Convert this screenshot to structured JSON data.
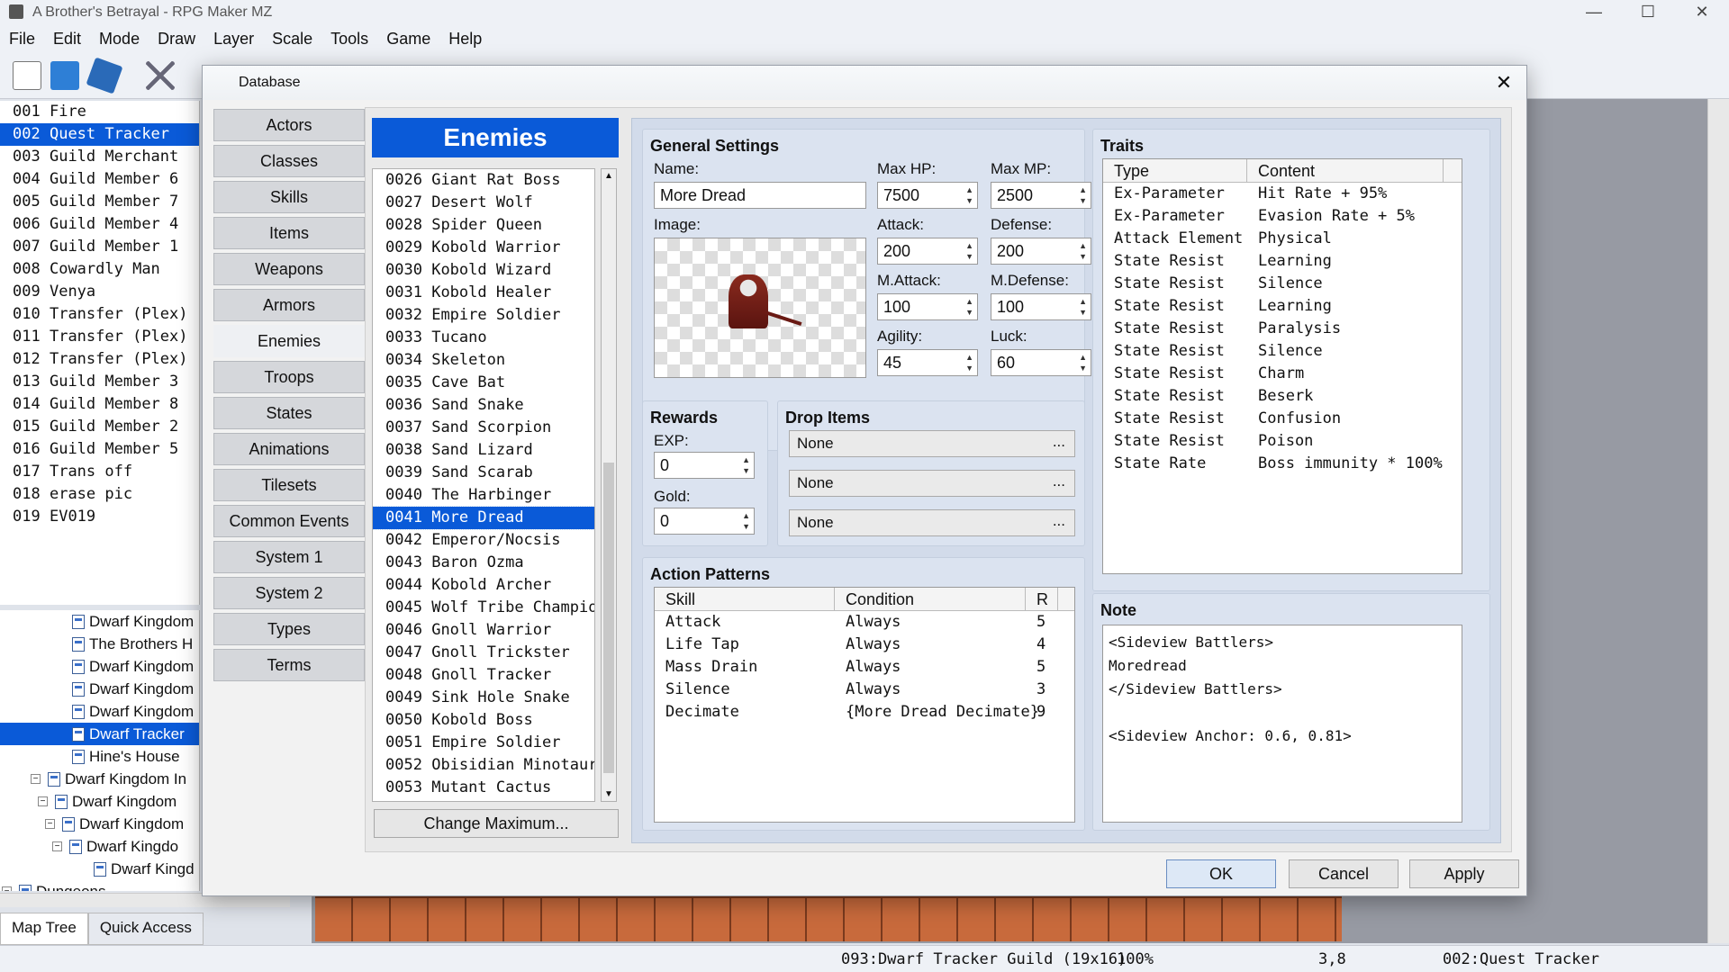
{
  "app": {
    "title": "A Brother's Betrayal - RPG Maker MZ",
    "menus": [
      "File",
      "Edit",
      "Mode",
      "Draw",
      "Layer",
      "Scale",
      "Tools",
      "Game",
      "Help"
    ],
    "win_controls": [
      "—",
      "☐",
      "✕"
    ]
  },
  "events": [
    {
      "id": "001",
      "name": "Fire"
    },
    {
      "id": "002",
      "name": "Quest Tracker"
    },
    {
      "id": "003",
      "name": "Guild Merchant"
    },
    {
      "id": "004",
      "name": "Guild Member 6"
    },
    {
      "id": "005",
      "name": "Guild Member 7"
    },
    {
      "id": "006",
      "name": "Guild Member 4"
    },
    {
      "id": "007",
      "name": "Guild Member 1"
    },
    {
      "id": "008",
      "name": "Cowardly Man"
    },
    {
      "id": "009",
      "name": "Venya"
    },
    {
      "id": "010",
      "name": "Transfer (Plex)"
    },
    {
      "id": "011",
      "name": "Transfer (Plex)"
    },
    {
      "id": "012",
      "name": "Transfer (Plex)"
    },
    {
      "id": "013",
      "name": "Guild Member 3"
    },
    {
      "id": "014",
      "name": "Guild Member 8"
    },
    {
      "id": "015",
      "name": "Guild Member 2"
    },
    {
      "id": "016",
      "name": "Guild Member 5"
    },
    {
      "id": "017",
      "name": "Trans off"
    },
    {
      "id": "018",
      "name": "erase pic"
    },
    {
      "id": "019",
      "name": "EV019"
    }
  ],
  "maptree": [
    "Dwarf Kingdom",
    "The Brothers H",
    "Dwarf Kingdom",
    "Dwarf Kingdom",
    "Dwarf Kingdom",
    "Dwarf Tracker",
    "Hine's House",
    "Dwarf Kingdom In",
    "Dwarf Kingdom",
    "Dwarf Kingdom",
    "Dwarf Kingdo",
    "Dwarf Kingd",
    "Dungeons"
  ],
  "bottom_tabs": [
    "Map Tree",
    "Quick Access"
  ],
  "status": {
    "map": "093:Dwarf Tracker Guild (19x16)",
    "zoom": "100%",
    "coords": "3,8",
    "event": "002:Quest Tracker"
  },
  "dialog": {
    "title": "Database",
    "close": "✕",
    "categories": [
      "Actors",
      "Classes",
      "Skills",
      "Items",
      "Weapons",
      "Armors",
      "Enemies",
      "Troops",
      "States",
      "Animations",
      "Tilesets",
      "Common Events",
      "System 1",
      "System 2",
      "Types",
      "Terms"
    ],
    "header": "Enemies",
    "enemies": [
      {
        "id": "0026",
        "name": "Giant Rat Boss"
      },
      {
        "id": "0027",
        "name": "Desert Wolf"
      },
      {
        "id": "0028",
        "name": "Spider Queen"
      },
      {
        "id": "0029",
        "name": "Kobold Warrior"
      },
      {
        "id": "0030",
        "name": "Kobold Wizard"
      },
      {
        "id": "0031",
        "name": "Kobold Healer"
      },
      {
        "id": "0032",
        "name": "Empire Soldier"
      },
      {
        "id": "0033",
        "name": "Tucano"
      },
      {
        "id": "0034",
        "name": "Skeleton"
      },
      {
        "id": "0035",
        "name": "Cave Bat"
      },
      {
        "id": "0036",
        "name": "Sand Snake"
      },
      {
        "id": "0037",
        "name": "Sand Scorpion"
      },
      {
        "id": "0038",
        "name": "Sand Lizard"
      },
      {
        "id": "0039",
        "name": "Sand Scarab"
      },
      {
        "id": "0040",
        "name": "The Harbinger"
      },
      {
        "id": "0041",
        "name": "More Dread"
      },
      {
        "id": "0042",
        "name": "Emperor/Nocsis"
      },
      {
        "id": "0043",
        "name": "Baron Ozma"
      },
      {
        "id": "0044",
        "name": "Kobold Archer"
      },
      {
        "id": "0045",
        "name": "Wolf Tribe Champion"
      },
      {
        "id": "0046",
        "name": "Gnoll Warrior"
      },
      {
        "id": "0047",
        "name": "Gnoll Trickster"
      },
      {
        "id": "0048",
        "name": "Gnoll Tracker"
      },
      {
        "id": "0049",
        "name": "Sink Hole Snake"
      },
      {
        "id": "0050",
        "name": "Kobold Boss"
      },
      {
        "id": "0051",
        "name": "Empire Soldier"
      },
      {
        "id": "0052",
        "name": "Obisidian Minotaur"
      },
      {
        "id": "0053",
        "name": "Mutant Cactus"
      }
    ],
    "change_max": "Change Maximum...",
    "general": {
      "title": "General Settings",
      "name_label": "Name:",
      "name": "More Dread",
      "image_label": "Image:",
      "maxhp_label": "Max HP:",
      "maxhp": "7500",
      "maxmp_label": "Max MP:",
      "maxmp": "2500",
      "atk_label": "Attack:",
      "atk": "200",
      "def_label": "Defense:",
      "def": "200",
      "matk_label": "M.Attack:",
      "matk": "100",
      "mdef_label": "M.Defense:",
      "mdef": "100",
      "agi_label": "Agility:",
      "agi": "45",
      "luk_label": "Luck:",
      "luk": "60"
    },
    "rewards": {
      "title": "Rewards",
      "exp_label": "EXP:",
      "exp": "0",
      "gold_label": "Gold:",
      "gold": "0"
    },
    "drops": {
      "title": "Drop Items",
      "items": [
        "None",
        "None",
        "None"
      ],
      "dots": "..."
    },
    "actions": {
      "title": "Action Patterns",
      "cols": [
        "Skill",
        "Condition",
        "R"
      ],
      "rows": [
        [
          "Attack",
          "Always",
          "5"
        ],
        [
          "Life Tap",
          "Always",
          "4"
        ],
        [
          "Mass Drain",
          "Always",
          "5"
        ],
        [
          "Silence",
          "Always",
          "3"
        ],
        [
          "Decimate",
          "{More Dread Decimate}",
          "9"
        ]
      ]
    },
    "traits": {
      "title": "Traits",
      "cols": [
        "Type",
        "Content"
      ],
      "rows": [
        [
          "Ex-Parameter",
          "Hit Rate + 95%"
        ],
        [
          "Ex-Parameter",
          "Evasion Rate + 5%"
        ],
        [
          "Attack Element",
          "Physical"
        ],
        [
          "State Resist",
          "Learning"
        ],
        [
          "State Resist",
          "Silence"
        ],
        [
          "State Resist",
          "Learning"
        ],
        [
          "State Resist",
          "Paralysis"
        ],
        [
          "State Resist",
          "Silence"
        ],
        [
          "State Resist",
          "Charm"
        ],
        [
          "State Resist",
          "Beserk"
        ],
        [
          "State Resist",
          "Confusion"
        ],
        [
          "State Resist",
          "Poison"
        ],
        [
          "State Rate",
          "Boss immunity  * 100%"
        ]
      ]
    },
    "note": {
      "title": "Note",
      "lines": [
        "<Sideview Battlers>",
        "Moredread",
        "</Sideview Battlers>",
        "",
        "<Sideview Anchor: 0.6, 0.81>"
      ]
    },
    "buttons": {
      "ok": "OK",
      "cancel": "Cancel",
      "apply": "Apply"
    }
  }
}
